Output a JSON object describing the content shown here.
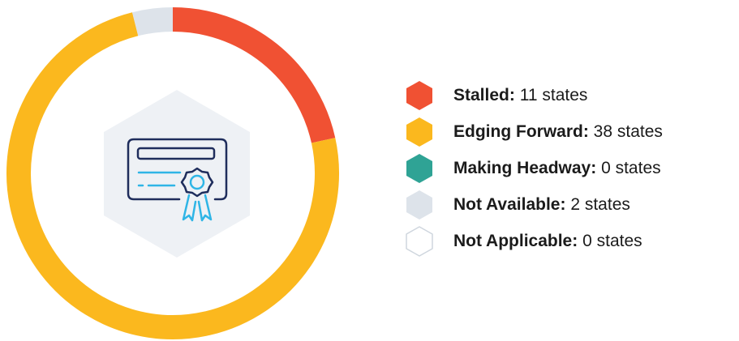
{
  "chart_data": {
    "type": "pie",
    "variant": "donut",
    "center_icon": "certificate-icon",
    "slices": [
      {
        "label": "Stalled:",
        "value": 11,
        "unit": "states",
        "color": "#f05133"
      },
      {
        "label": "Edging Forward:",
        "value": 38,
        "unit": "states",
        "color": "#fbb81e"
      },
      {
        "label": "Making Headway:",
        "value": 0,
        "unit": "states",
        "color": "#2fa395"
      },
      {
        "label": "Not Available:",
        "value": 2,
        "unit": "states",
        "color": "#dde3ea"
      },
      {
        "label": "Not Applicable:",
        "value": 0,
        "unit": "states",
        "color": "#ffffff"
      }
    ],
    "legend_position": "right"
  },
  "colors": {
    "hexagon_bg": "#eef1f5",
    "icon_stroke_dark": "#1f2d5c",
    "icon_stroke_accent": "#2fb5e6",
    "outline": "#cfd6de"
  }
}
